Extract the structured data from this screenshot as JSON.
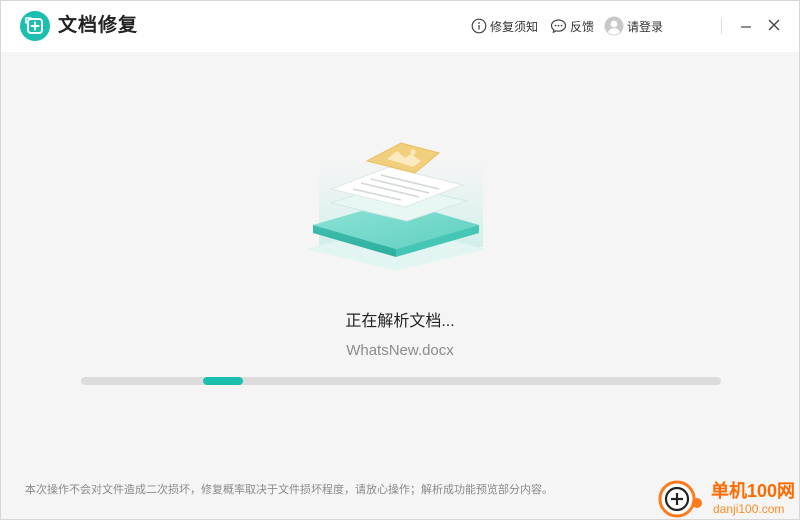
{
  "app": {
    "title": "文档修复",
    "accent": "#1bbfae"
  },
  "header": {
    "notice_label": "修复须知",
    "feedback_label": "反馈",
    "login_label": "请登录",
    "icons": [
      "info-icon",
      "chat-bubble-icon",
      "user-avatar-icon",
      "minimize-icon",
      "close-icon"
    ]
  },
  "main": {
    "status": "正在解析文档...",
    "file_name": "WhatsNew.docx",
    "progress_color": "#1bbfae",
    "progress_track_color": "#dcdcdc"
  },
  "footer": {
    "note": "本次操作不会对文件造成二次损坏，修复概率取决于文件损坏程度，请放心操作；解析成功能预览部分内容。"
  },
  "watermark": {
    "brand": "单机100网",
    "site": "danji100.com"
  }
}
